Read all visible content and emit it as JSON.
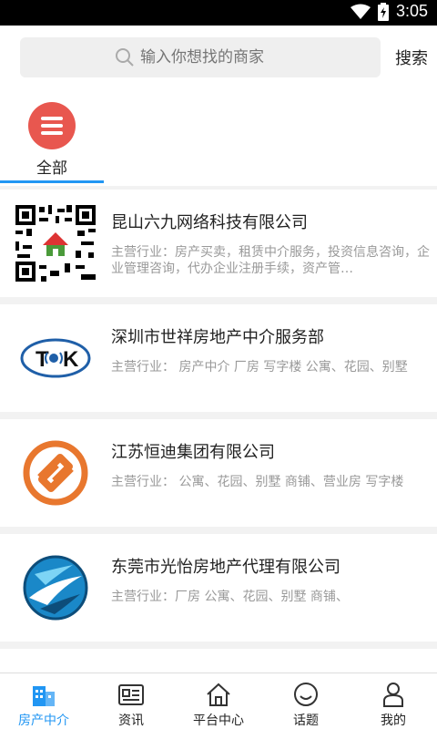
{
  "status_bar": {
    "time": "3:05"
  },
  "search": {
    "placeholder": "输入你想找的商家",
    "button_label": "搜索"
  },
  "category": {
    "label": "全部"
  },
  "merchants": [
    {
      "name": "昆山六九网络科技有限公司",
      "description": "主营行业：房产买卖，租赁中介服务，投资信息咨询，企业管理咨询，代办企业注册手续，资产管…",
      "logo": "qr-code-logo"
    },
    {
      "name": "深圳市世祥房地产中介服务部",
      "description": "主营行业：   房产中介 厂房 写字楼 公寓、花园、别墅",
      "logo": "tok-logo",
      "logo_text": "TK"
    },
    {
      "name": "江苏恒迪集团有限公司",
      "description": "主营行业：   公寓、花园、别墅 商铺、营业房 写字楼",
      "logo": "orange-s-logo"
    },
    {
      "name": "东莞市光怡房地产代理有限公司",
      "description": "主营行业：厂房 公寓、花园、别墅 商铺、",
      "logo": "blue-swoosh-logo"
    },
    {
      "name": "",
      "description": "",
      "logo": ""
    }
  ],
  "tabs": [
    {
      "label": "房产中介",
      "icon": "building-icon",
      "active": true
    },
    {
      "label": "资讯",
      "icon": "news-icon",
      "active": false
    },
    {
      "label": "平台中心",
      "icon": "home-icon",
      "active": false
    },
    {
      "label": "话题",
      "icon": "smile-icon",
      "active": false
    },
    {
      "label": "我的",
      "icon": "person-icon",
      "active": false
    }
  ],
  "colors": {
    "accent": "#2196f3",
    "category_circle": "#e8574f",
    "muted_text": "#999999"
  }
}
